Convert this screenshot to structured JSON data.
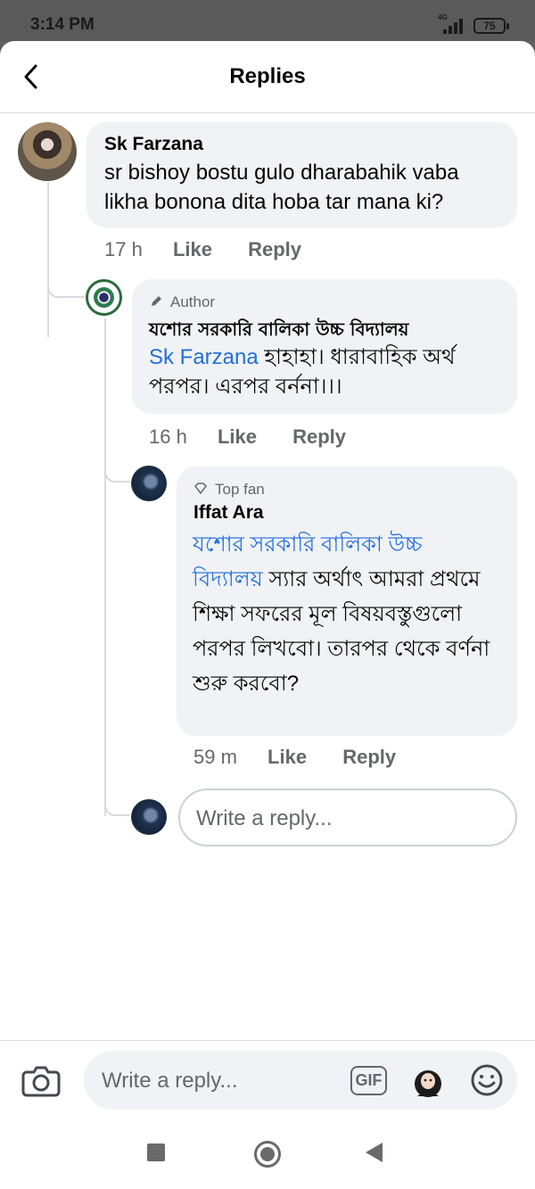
{
  "status_bar": {
    "time": "3:14 PM",
    "network": "4G",
    "battery": "75"
  },
  "header": {
    "title": "Replies",
    "back_icon": "chevron-left-icon"
  },
  "comments": [
    {
      "author": "Sk Farzana",
      "text": "sr bishoy bostu gulo dharabahik vaba likha bonona dita hoba tar mana ki?",
      "time": "17 h",
      "like": "Like",
      "reply": "Reply"
    },
    {
      "badge": "Author",
      "badge_icon": "pencil-icon",
      "author": "যশোর সরকারি বালিকা উচ্চ বিদ্যালয়",
      "mention": "Sk Farzana",
      "text": "হাহাহা। ধারাবাহিক অর্থ পরপর। এরপর বর্ননা।।।",
      "time": "16 h",
      "like": "Like",
      "reply": "Reply"
    },
    {
      "badge": "Top fan",
      "badge_icon": "diamond-icon",
      "author": "Iffat Ara",
      "mention": "যশোর সরকারি বালিকা উচ্চ বিদ্যালয়",
      "text": "স্যার অর্থাৎ আমরা প্রথমে শিক্ষা সফরের মূল বিষয়বস্তুগুলো পরপর লিখবো। তারপর থেকে বর্ণনা শুরু করবো?",
      "time": "59 m",
      "like": "Like",
      "reply": "Reply"
    }
  ],
  "inline_reply": {
    "placeholder": "Write a reply..."
  },
  "composer": {
    "placeholder": "Write a reply...",
    "gif_label": "GIF",
    "camera_icon": "camera-icon",
    "avatar_icon": "avatar-sticker-icon",
    "emoji_icon": "emoji-icon"
  },
  "nav": {
    "square_icon": "recent-apps-icon",
    "home_icon": "home-icon",
    "back_icon": "back-icon"
  },
  "colors": {
    "accent": "#216fdb",
    "bubble": "#f0f2f5",
    "meta": "#65676b"
  }
}
